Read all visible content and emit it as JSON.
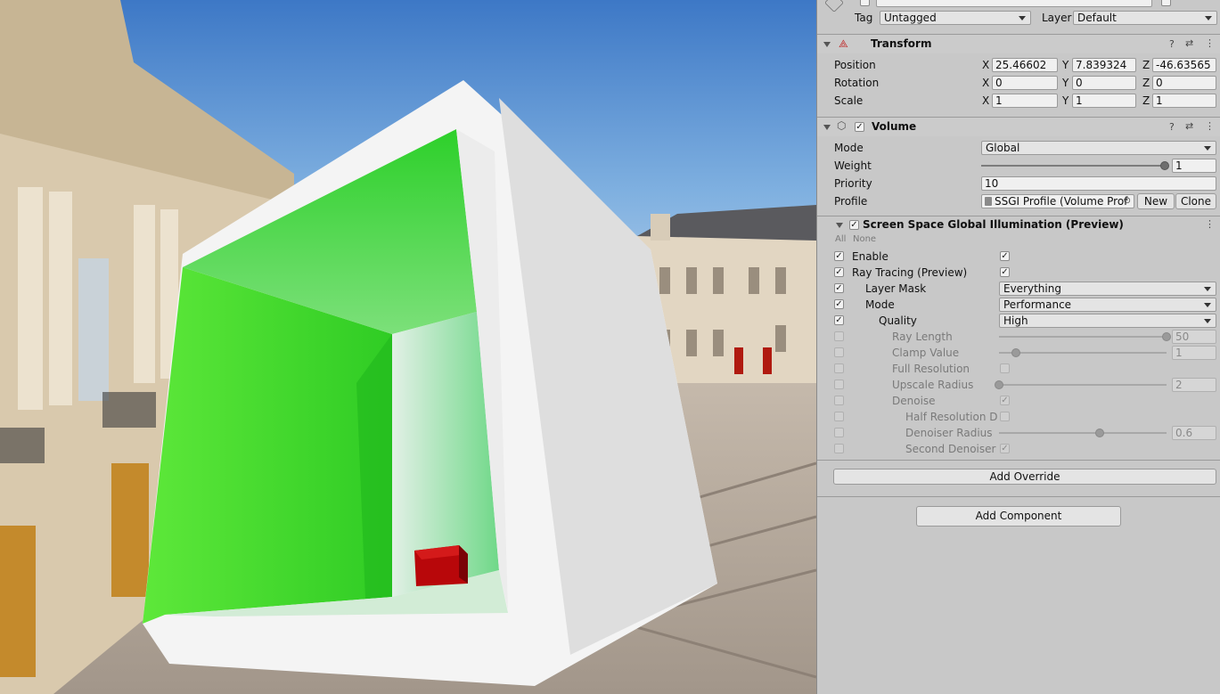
{
  "header": {
    "tag_label": "Tag",
    "tag_value": "Untagged",
    "layer_label": "Layer",
    "layer_value": "Default"
  },
  "transform": {
    "title": "Transform",
    "position_label": "Position",
    "rotation_label": "Rotation",
    "scale_label": "Scale",
    "position": {
      "x": "25.46602",
      "y": "7.839324",
      "z": "-46.63565"
    },
    "rotation": {
      "x": "0",
      "y": "0",
      "z": "0"
    },
    "scale": {
      "x": "1",
      "y": "1",
      "z": "1"
    },
    "axis_x": "X",
    "axis_y": "Y",
    "axis_z": "Z"
  },
  "volume": {
    "title": "Volume",
    "mode_label": "Mode",
    "mode_value": "Global",
    "weight_label": "Weight",
    "weight_value": "1",
    "weight_fraction": 1.0,
    "priority_label": "Priority",
    "priority_value": "10",
    "profile_label": "Profile",
    "profile_value": "SSGI Profile (Volume Prof",
    "new_label": "New",
    "clone_label": "Clone"
  },
  "ssgi": {
    "title": "Screen Space Global Illumination (Preview)",
    "all_label": "All",
    "none_label": "None",
    "rows": {
      "enable": "Enable",
      "ray_tracing": "Ray Tracing (Preview)",
      "layer_mask": "Layer Mask",
      "layer_mask_value": "Everything",
      "mode": "Mode",
      "mode_value": "Performance",
      "quality": "Quality",
      "quality_value": "High",
      "ray_length": "Ray Length",
      "ray_length_value": "50",
      "ray_length_fraction": 1.0,
      "clamp_value": "Clamp Value",
      "clamp_value_value": "1",
      "clamp_value_fraction": 0.1,
      "full_resolution": "Full Resolution",
      "upscale_radius": "Upscale Radius",
      "upscale_radius_value": "2",
      "upscale_radius_fraction": 0.0,
      "denoise": "Denoise",
      "half_resolution": "Half Resolution De",
      "denoiser_radius": "Denoiser Radius",
      "denoiser_radius_value": "0.6",
      "denoiser_radius_fraction": 0.6,
      "second_denoiser": "Second Denoiser F"
    }
  },
  "add_override_label": "Add Override",
  "add_component_label": "Add Component"
}
